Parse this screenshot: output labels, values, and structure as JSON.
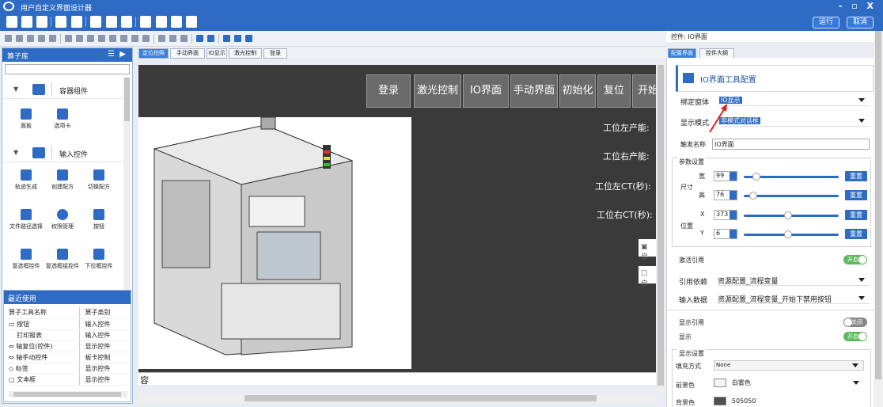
{
  "window": {
    "title": "用户自定义界面设计器",
    "controls": "- ▫ X"
  },
  "toolbar": {
    "run_label": "运行",
    "cancel_label": "取消"
  },
  "left_panel": {
    "title": "算子库",
    "sections": [
      {
        "label": "容器组件",
        "tools": [
          "面板",
          "选项卡"
        ]
      },
      {
        "label": "输入控件",
        "tools": [
          "轨迹生成",
          "创建配方",
          "切换配方",
          "文件路径选择",
          "权限管理",
          "按钮",
          "复选框控件",
          "复选框组控件",
          "下拉框控件"
        ]
      }
    ]
  },
  "recent": {
    "title": "最近使用",
    "headers": [
      "算子工具名称",
      "算子类别"
    ],
    "rows": [
      [
        "按钮",
        "输入控件"
      ],
      [
        "打印报表",
        "输入控件"
      ],
      [
        "轴复位(控件)",
        "显示控件"
      ],
      [
        "轴手动控件",
        "板卡控制"
      ],
      [
        "标签",
        "显示控件"
      ],
      [
        "文本框",
        "显示控件"
      ]
    ]
  },
  "center_tabs": [
    "定位拍照",
    "手动界面",
    "IO显示",
    "激光控制",
    "登录"
  ],
  "canvas": {
    "nav_buttons": [
      "登录",
      "激光控制",
      "IO界面",
      "手动界面",
      "初始化",
      "复位",
      "开始"
    ],
    "stats": [
      "工位左产能:",
      "工位右产能:",
      "工位左CT(秒):",
      "工位右CT(秒):"
    ],
    "checkboxes": [
      "启",
      "启"
    ],
    "input_text": "容"
  },
  "right_panel": {
    "control_label": "控件: IO界面",
    "tabs": [
      "配置界面",
      "控件大纲"
    ],
    "header": "IO界面工具配置",
    "bind_window": {
      "label": "绑定窗体",
      "value": "IO显示"
    },
    "display_mode": {
      "label": "显示模式",
      "value": "非模式对话框"
    },
    "trigger_name": {
      "label": "触发名称",
      "value": "IO界面"
    },
    "params": {
      "title": "参数设置",
      "size_label": "尺寸",
      "pos_label": "位置",
      "rows": [
        {
          "label": "宽",
          "value": "99",
          "level": 0.1
        },
        {
          "label": "高",
          "value": "76",
          "level": 0.06
        },
        {
          "label": "X",
          "value": "373",
          "level": 0.46
        },
        {
          "label": "Y",
          "value": "6",
          "level": 0.46
        }
      ],
      "reset_label": "重置"
    },
    "activate_ref": {
      "label": "激活引用",
      "state": "开启"
    },
    "ref_dep": {
      "label": "引用依赖",
      "value": "资源配置_流程变量"
    },
    "input_data": {
      "label": "输入数据",
      "value": "资源配置_流程变量_开始下禁用按钮"
    },
    "show_ref": {
      "label": "显示引用",
      "state": "关闭"
    },
    "show": {
      "label": "显示",
      "state": "开启"
    },
    "display": {
      "title": "显示设置",
      "fill_mode": {
        "label": "填充方式",
        "value": "None"
      },
      "fore_color": {
        "label": "前景色",
        "value": "白雾色"
      },
      "back_color": {
        "label": "背景色",
        "value": "505050"
      }
    }
  },
  "colors": {
    "accent": "#2d6bc4",
    "canvas_bg": "#3a3a3a",
    "toggle_on": "#5eb95e"
  }
}
